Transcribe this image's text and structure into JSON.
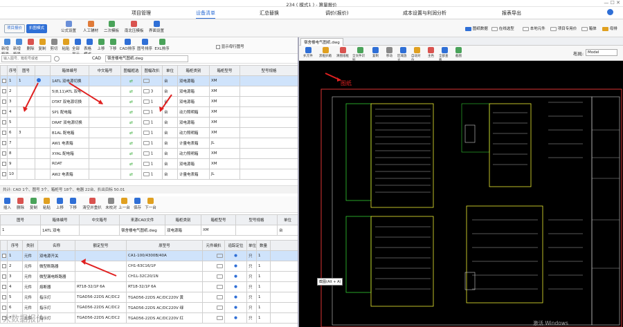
{
  "window": {
    "title": "234 ( 模式1 ) - 算量报价"
  },
  "menu": [
    "项目管理",
    "设备清单",
    "汇总替换",
    "调价(报价)",
    "成本设置与利润分析",
    "报表导出"
  ],
  "ribbon": {
    "mode_tabs": [
      "项目报价",
      "扒图模式"
    ],
    "buttons": [
      "公式设置",
      "人工辅材",
      "二次模板",
      "南北压模板",
      "界面设置"
    ],
    "right_buttons": [
      "图纸数据",
      "在线选型",
      "本地元件",
      "项目专用价",
      "箱体",
      "母排"
    ]
  },
  "toolbar1": [
    "新增箱号",
    "新增箱号",
    "删除",
    "复制",
    "剪切",
    "粘贴",
    "全部显示",
    "表格模式",
    "上移",
    "下移",
    "CAD排序",
    "图号排序",
    "EXL排序"
  ],
  "toolbar1_check": "显示母行图号",
  "filter": {
    "placeholder": "输入图号、箱柜号或者",
    "cad_label": "CAD",
    "cad_value": "宿舍楼电气图纸.dwg"
  },
  "top_table": {
    "headers": [
      "序号",
      "图号",
      "",
      "箱体编号",
      "中文箱号",
      "图幅框选",
      "图幅改扒",
      "单位",
      "箱柜类别",
      "箱柜型号",
      "型号规格"
    ],
    "rows": [
      [
        "1",
        "1",
        "",
        "1ATL 双电源切换",
        "",
        "",
        "",
        "台",
        "双电源箱",
        "XM",
        ""
      ],
      [
        "2",
        "",
        "",
        "5(8,11)ATL 双电",
        "",
        "",
        "3",
        "台",
        "双电源箱",
        "XM",
        ""
      ],
      [
        "3",
        "",
        "",
        "DTAT 双电源切换",
        "",
        "",
        "1",
        "台",
        "双电源箱",
        "XM",
        ""
      ],
      [
        "4",
        "",
        "",
        "SP1 配电箱",
        "",
        "",
        "1",
        "台",
        "动力照明箱",
        "XM",
        ""
      ],
      [
        "5",
        "",
        "",
        "DRAT 双电源切换",
        "",
        "",
        "1",
        "台",
        "双电源箱",
        "XM",
        ""
      ],
      [
        "6",
        "3",
        "",
        "B1AL 配电箱",
        "",
        "",
        "1",
        "台",
        "动力照明箱",
        "XM",
        ""
      ],
      [
        "7",
        "",
        "",
        "AW1 电表箱",
        "",
        "",
        "1",
        "台",
        "计量电表箱",
        "JL",
        ""
      ],
      [
        "8",
        "",
        "",
        "XYAL 配电箱",
        "",
        "",
        "1",
        "台",
        "动力照明箱",
        "XM",
        ""
      ],
      [
        "9",
        "",
        "",
        "RDAT",
        "",
        "",
        "1",
        "台",
        "双电源箱",
        "XM",
        ""
      ],
      [
        "10",
        "",
        "",
        "AW2 电表箱",
        "",
        "",
        "1",
        "台",
        "计量电表箱",
        "JL",
        ""
      ]
    ]
  },
  "status": "共计: CAD 1个、图号 3个、箱柜号 18个、电器 22台、扒出目标 50.01",
  "toolbar2": [
    "插入",
    "删除",
    "复制",
    "粘贴",
    "上移",
    "下移",
    "清空并重扒",
    "未校对",
    "上一台",
    "保存",
    "下一台"
  ],
  "box_info": {
    "headers": [
      "图号",
      "箱体编号",
      "中文箱号",
      "来源CAD文件",
      "箱柜类别",
      "箱柜型号",
      "型号规格",
      "单位"
    ],
    "values": [
      "1",
      "1ATL 双电",
      "",
      "宿舍楼电气图纸.dwg",
      "双电源箱",
      "XM",
      "",
      "台"
    ]
  },
  "parts_table": {
    "headers": [
      "序号",
      "类别",
      "名称",
      "额定型号",
      "原型号",
      "元件编扒",
      "追踪定位",
      "单位",
      "数量",
      ""
    ],
    "rows": [
      [
        "1",
        "元件",
        "双电源开关",
        "",
        "CA1-100/4300B/40A",
        "",
        "",
        "只",
        "1",
        ""
      ],
      [
        "2",
        "元件",
        "微型断路器",
        "",
        "CH1-63C16/1P",
        "",
        "",
        "只",
        "1",
        ""
      ],
      [
        "3",
        "元件",
        "微型漏电断路器",
        "",
        "CH1L-32C20/1N",
        "",
        "",
        "只",
        "1",
        ""
      ],
      [
        "4",
        "元件",
        "熔断器",
        "RT18-32/1P 6A",
        "RT18-32/1P 6A",
        "",
        "",
        "只",
        "1",
        ""
      ],
      [
        "5",
        "元件",
        "指示灯",
        "TGAD56-22DS AC/DC2",
        "TGAD56-22DS AC/DC220V 黄",
        "",
        "",
        "只",
        "1",
        ""
      ],
      [
        "6",
        "元件",
        "指示灯",
        "TGAD56-22DS AC/DC2",
        "TGAD56-22DS AC/DC220V 绿",
        "",
        "",
        "只",
        "1",
        ""
      ],
      [
        "7",
        "元件",
        "指示灯",
        "TGAD56-22DS AC/DC2",
        "TGAD56-22DS AC/DC220V 红",
        "",
        "",
        "只",
        "1",
        ""
      ]
    ]
  },
  "right": {
    "tab": "宿舍楼电气图纸.dwg",
    "toolbar": [
      "扒元件",
      "黑框扒箱",
      "清图纸框",
      "全文件识别",
      "复制",
      "移动",
      "区域放大",
      "自动对位",
      "主色",
      "全部查看",
      "截图"
    ],
    "layout_label": "布局:",
    "layout_value": "Model",
    "red_label": "图纸",
    "tooltip": "截图(Alt + A)",
    "watermark": "激活 Windows"
  },
  "brand_watermark": "大数据报价"
}
